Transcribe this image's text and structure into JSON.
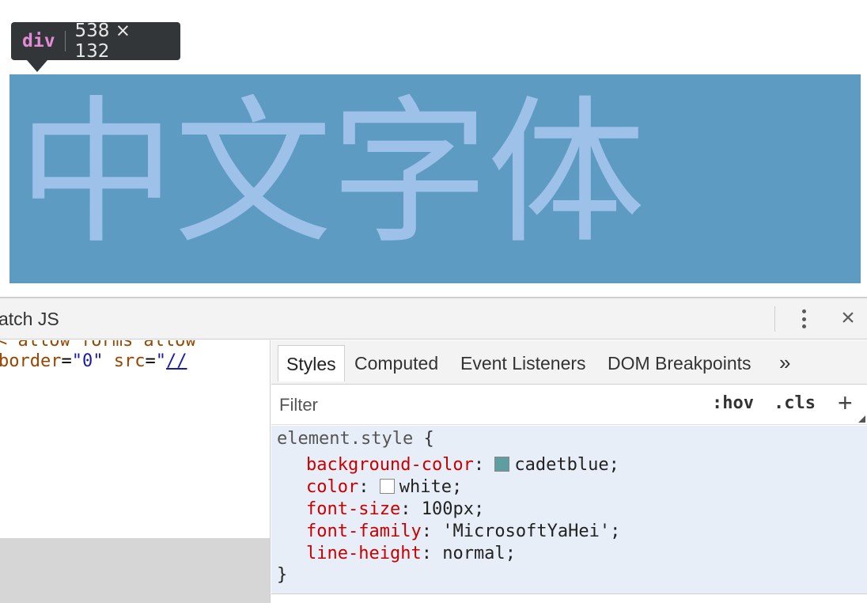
{
  "tooltip": {
    "tag": "div",
    "dims": "538 × 132"
  },
  "element": {
    "text": "中文字体",
    "background": "#5e9bc2",
    "text_color": "#9dc1e8"
  },
  "devtools": {
    "topbar_label": "atch JS",
    "elements": {
      "line0": "< allow forms allow",
      "attr1_name": "border",
      "attr1_eq": "=",
      "attr1_value": "\"0\"",
      "attr2_name": "src",
      "attr2_eq": "=",
      "attr2_quote": "\"",
      "attr2_link": "//"
    },
    "tabs": [
      {
        "label": "Styles"
      },
      {
        "label": "Computed"
      },
      {
        "label": "Event Listeners"
      },
      {
        "label": "DOM Breakpoints"
      }
    ],
    "tab_more": "»",
    "filter": {
      "placeholder": "Filter",
      "hov": ":hov",
      "cls": ".cls",
      "add": "+"
    },
    "rule": {
      "selector": "element.style",
      "open_brace": "{",
      "close_brace": "}",
      "properties": [
        {
          "name": "background-color",
          "value": "cadetblue",
          "swatch": "#5f9ea0"
        },
        {
          "name": "color",
          "value": "white",
          "swatch": "#ffffff"
        },
        {
          "name": "font-size",
          "value": "100px"
        },
        {
          "name": "font-family",
          "value": "'MicrosoftYaHei'"
        },
        {
          "name": "line-height",
          "value": "normal"
        }
      ]
    },
    "close_label": "×"
  }
}
